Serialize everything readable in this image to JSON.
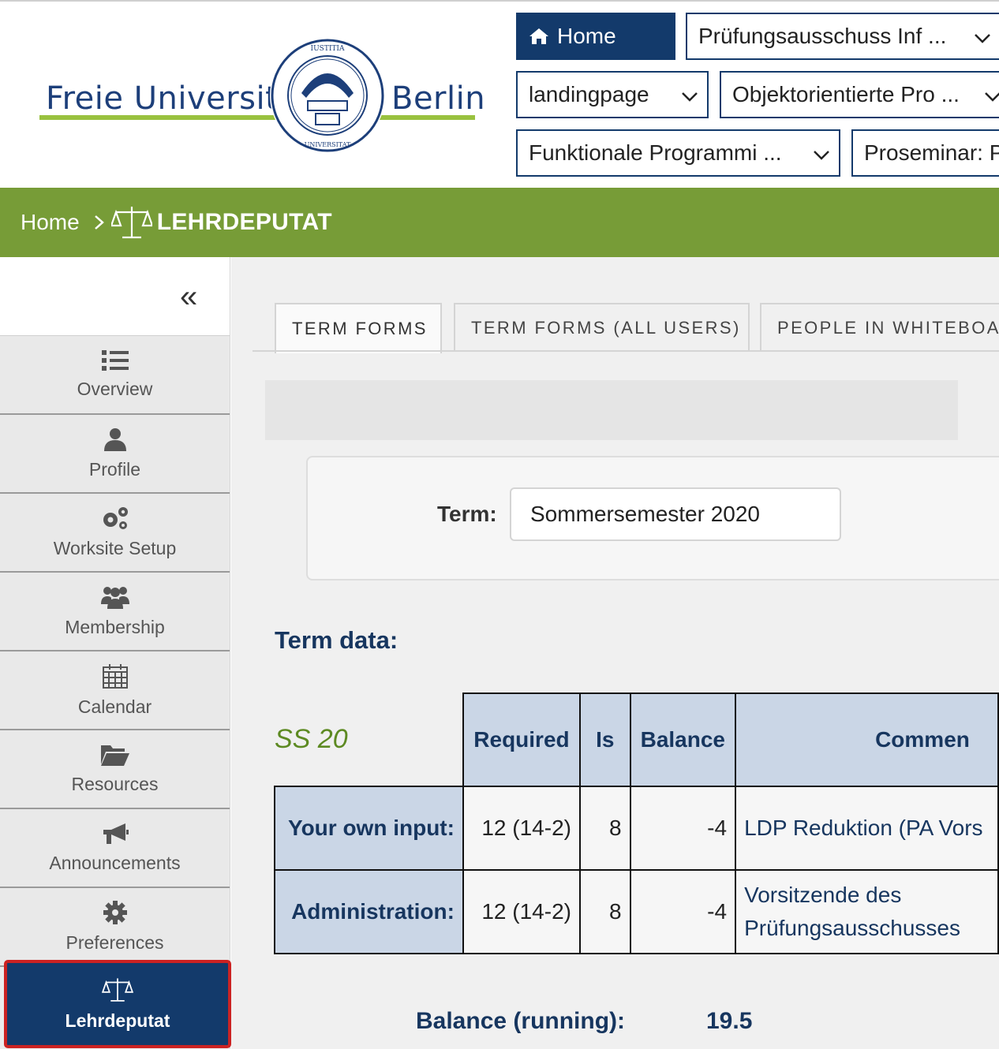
{
  "university": {
    "name_left": "Freie Universität",
    "name_right": "Berlin",
    "seal_text": [
      "IUSTITIA",
      "LIBERTAS",
      "VERITAS",
      "FREIE UNIVERSITÄT BERLIN"
    ]
  },
  "top_nav": {
    "home_label": "Home",
    "sites": [
      "Prüfungsausschuss Inf ...",
      "landingpage",
      "Objektorientierte Pro ...",
      "Funktionale Programmi ...",
      "Proseminar: P"
    ]
  },
  "breadcrumb": {
    "home": "Home",
    "tool": "LEHRDEPUTAT"
  },
  "sidebar": {
    "items": [
      {
        "label": "Overview",
        "icon": "list-icon"
      },
      {
        "label": "Profile",
        "icon": "user-icon"
      },
      {
        "label": "Worksite Setup",
        "icon": "gears-icon"
      },
      {
        "label": "Membership",
        "icon": "users-icon"
      },
      {
        "label": "Calendar",
        "icon": "calendar-icon"
      },
      {
        "label": "Resources",
        "icon": "folder-open-icon"
      },
      {
        "label": "Announcements",
        "icon": "bullhorn-icon"
      },
      {
        "label": "Preferences",
        "icon": "gear-icon"
      }
    ],
    "active_item": {
      "label": "Lehrdeputat",
      "icon": "scales-icon"
    }
  },
  "tabs": [
    "TERM FORMS",
    "TERM FORMS (ALL USERS)",
    "PEOPLE IN WHITEBOAR"
  ],
  "term": {
    "label": "Term:",
    "value": "Sommersemester 2020"
  },
  "term_data": {
    "title": "Term data:",
    "semester": "SS 20",
    "columns": [
      "Required",
      "Is",
      "Balance",
      "Commen"
    ],
    "rows": [
      {
        "label": "Your own input:",
        "required": "12 (14-2)",
        "is": "8",
        "balance": "-4",
        "comment": [
          "LDP Reduktion (PA Vors"
        ]
      },
      {
        "label": "Administration:",
        "required": "12 (14-2)",
        "is": "8",
        "balance": "-4",
        "comment": [
          "Vorsitzende des",
          "Prüfungsausschusses"
        ]
      }
    ]
  },
  "balance_running": {
    "label": "Balance (running):",
    "value": "19.5"
  },
  "colors": {
    "navy": "#133a6b",
    "green": "#779c37",
    "highlight": "#cc2222"
  }
}
